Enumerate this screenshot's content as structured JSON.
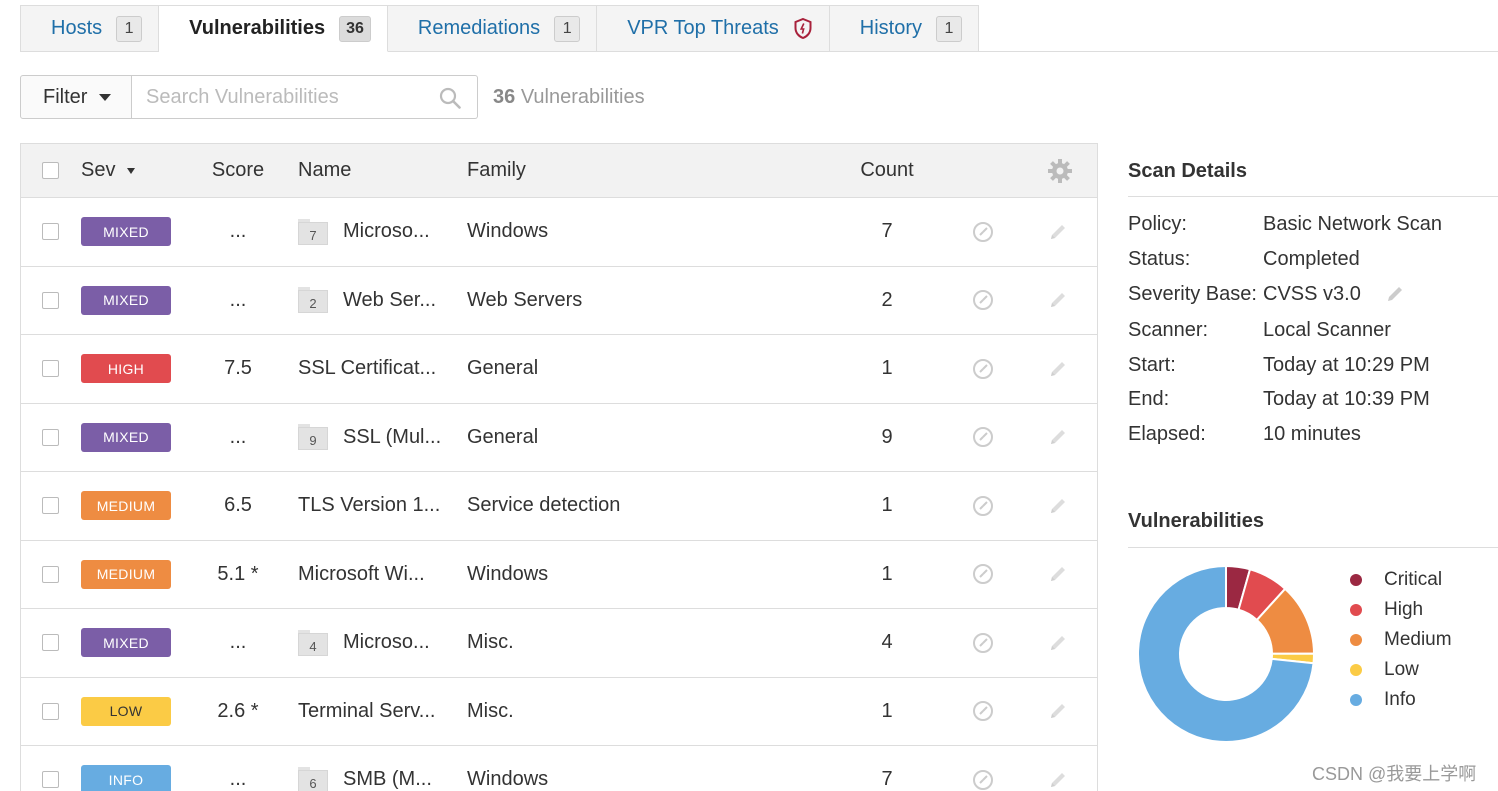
{
  "tabs": [
    {
      "label": "Hosts",
      "count": "1"
    },
    {
      "label": "Vulnerabilities",
      "count": "36"
    },
    {
      "label": "Remediations",
      "count": "1"
    },
    {
      "label": "VPR Top Threats",
      "icon": "shield-alert-icon"
    },
    {
      "label": "History",
      "count": "1"
    }
  ],
  "filter": {
    "button_label": "Filter",
    "search_placeholder": "Search Vulnerabilities",
    "count_value": "36",
    "count_label": "Vulnerabilities"
  },
  "table": {
    "headers": {
      "sev": "Sev",
      "score": "Score",
      "name": "Name",
      "family": "Family",
      "count": "Count"
    },
    "rows": [
      {
        "sev": "MIXED",
        "score": "...",
        "group": "7",
        "name": "Microso...",
        "family": "Windows",
        "count": "7"
      },
      {
        "sev": "MIXED",
        "score": "...",
        "group": "2",
        "name": "Web Ser...",
        "family": "Web Servers",
        "count": "2"
      },
      {
        "sev": "HIGH",
        "score": "7.5",
        "group": "",
        "name": "SSL Certificat...",
        "family": "General",
        "count": "1"
      },
      {
        "sev": "MIXED",
        "score": "...",
        "group": "9",
        "name": "SSL (Mul...",
        "family": "General",
        "count": "9"
      },
      {
        "sev": "MEDIUM",
        "score": "6.5",
        "group": "",
        "name": "TLS Version 1...",
        "family": "Service detection",
        "count": "1"
      },
      {
        "sev": "MEDIUM",
        "score": "5.1 *",
        "group": "",
        "name": "Microsoft Wi...",
        "family": "Windows",
        "count": "1"
      },
      {
        "sev": "MIXED",
        "score": "...",
        "group": "4",
        "name": "Microso...",
        "family": "Misc.",
        "count": "4"
      },
      {
        "sev": "LOW",
        "score": "2.6 *",
        "group": "",
        "name": "Terminal Serv...",
        "family": "Misc.",
        "count": "1"
      },
      {
        "sev": "INFO",
        "score": "...",
        "group": "6",
        "name": "SMB (M...",
        "family": "Windows",
        "count": "7"
      }
    ]
  },
  "severity_colors": {
    "MIXED": "#7b5ea7",
    "HIGH": "#e14b4f",
    "MEDIUM": "#ee8c42",
    "LOW": "#fbcb45",
    "INFO": "#67ace1",
    "CRITICAL": "#9b2842"
  },
  "scan_details": {
    "title": "Scan Details",
    "items": [
      {
        "label": "Policy:",
        "value": "Basic Network Scan"
      },
      {
        "label": "Status:",
        "value": "Completed"
      },
      {
        "label": "Severity Base:",
        "value": "CVSS v3.0"
      },
      {
        "label": "Scanner:",
        "value": "Local Scanner"
      },
      {
        "label": "Start:",
        "value": "Today at 10:29 PM"
      },
      {
        "label": "End:",
        "value": "Today at 10:39 PM"
      },
      {
        "label": "Elapsed:",
        "value": "10 minutes"
      }
    ]
  },
  "vulnerabilities_chart": {
    "title": "Vulnerabilities",
    "legend": [
      "Critical",
      "High",
      "Medium",
      "Low",
      "Info"
    ]
  },
  "chart_data": {
    "type": "pie",
    "categories": [
      "Critical",
      "High",
      "Medium",
      "Low",
      "Info"
    ],
    "values": [
      1.5,
      2.5,
      4.5,
      0.6,
      25
    ],
    "colors": [
      "#9b2842",
      "#e14b4f",
      "#ee8c42",
      "#fbcb45",
      "#67ace1"
    ]
  },
  "watermark": "CSDN @我要上学啊"
}
